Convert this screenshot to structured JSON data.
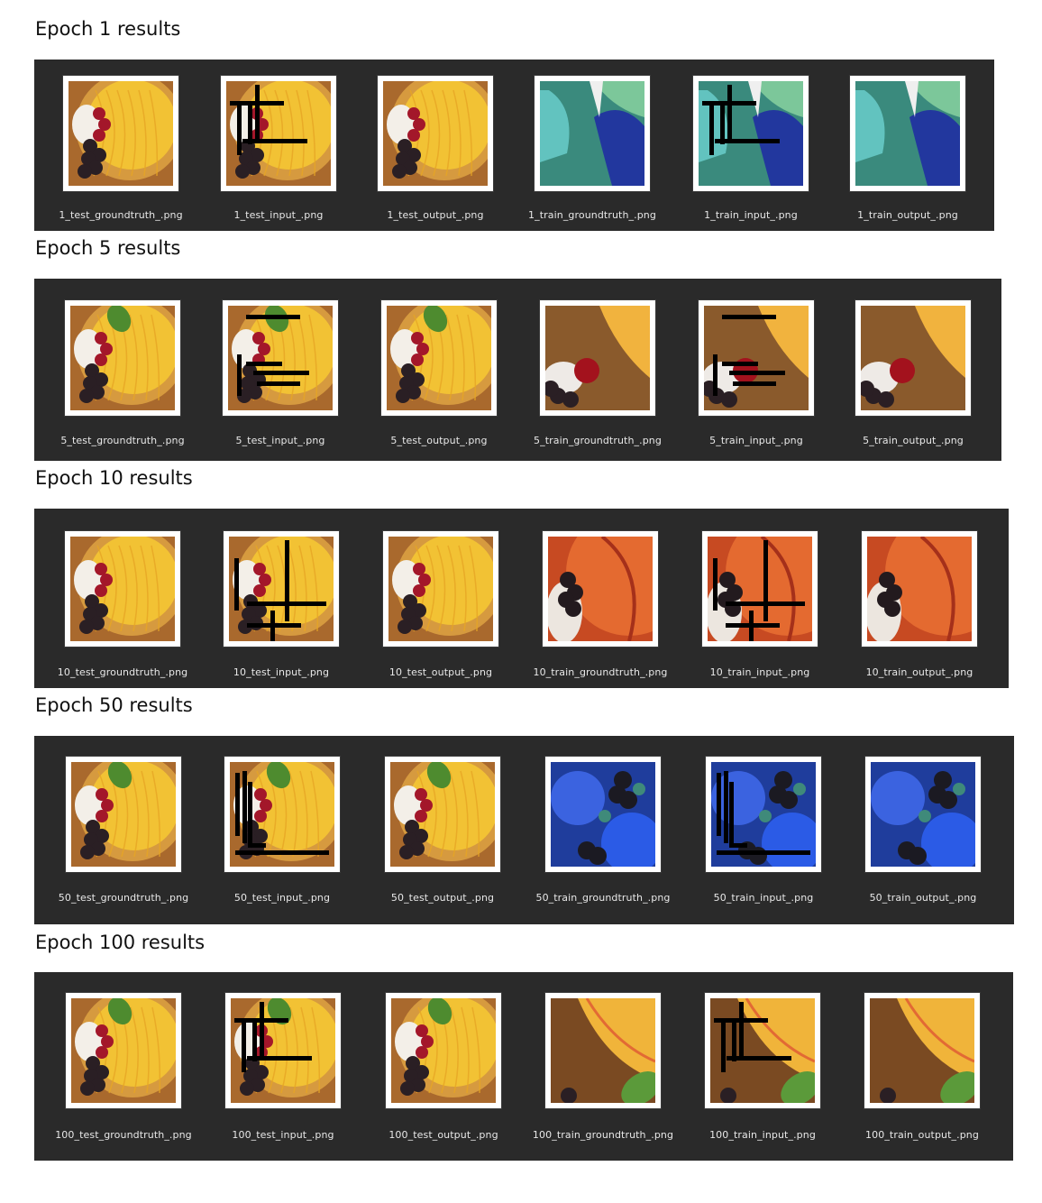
{
  "sections": [
    {
      "title": "Epoch 1 results",
      "files": [
        {
          "label": "1_test_groundtruth_.png",
          "scene": "tart",
          "mask": false,
          "accent": "#f2c234"
        },
        {
          "label": "1_test_input_.png",
          "scene": "tart",
          "mask": true,
          "accent": "#f2c234"
        },
        {
          "label": "1_test_output_.png",
          "scene": "tart",
          "mask": false,
          "accent": "#f2c234"
        },
        {
          "label": "1_train_groundtruth_.png",
          "scene": "teal",
          "mask": false,
          "accent": "#49b5a8"
        },
        {
          "label": "1_train_input_.png",
          "scene": "teal",
          "mask": true,
          "accent": "#49b5a8"
        },
        {
          "label": "1_train_output_.png",
          "scene": "teal",
          "mask": false,
          "accent": "#49b5a8"
        }
      ]
    },
    {
      "title": "Epoch 5 results",
      "files": [
        {
          "label": "5_test_groundtruth_.png",
          "scene": "tart-leaf",
          "mask": false,
          "accent": "#f2c234"
        },
        {
          "label": "5_test_input_.png",
          "scene": "tart-leaf",
          "mask": true,
          "accent": "#f2c234"
        },
        {
          "label": "5_test_output_.png",
          "scene": "tart-leaf",
          "mask": false,
          "accent": "#f2c234"
        },
        {
          "label": "5_train_groundtruth_.png",
          "scene": "cherry",
          "mask": false,
          "accent": "#e8a23c"
        },
        {
          "label": "5_train_input_.png",
          "scene": "cherry",
          "mask": true,
          "accent": "#e8a23c"
        },
        {
          "label": "5_train_output_.png",
          "scene": "cherry",
          "mask": false,
          "accent": "#e8a23c"
        }
      ]
    },
    {
      "title": "Epoch 10 results",
      "files": [
        {
          "label": "10_test_groundtruth_.png",
          "scene": "tart",
          "mask": false,
          "accent": "#f2c234"
        },
        {
          "label": "10_test_input_.png",
          "scene": "tart",
          "mask": true,
          "accent": "#f2c234"
        },
        {
          "label": "10_test_output_.png",
          "scene": "tart",
          "mask": false,
          "accent": "#f2c234"
        },
        {
          "label": "10_train_groundtruth_.png",
          "scene": "orange",
          "mask": false,
          "accent": "#e0602a"
        },
        {
          "label": "10_train_input_.png",
          "scene": "orange",
          "mask": true,
          "accent": "#e0602a"
        },
        {
          "label": "10_train_output_.png",
          "scene": "orange",
          "mask": false,
          "accent": "#e0602a"
        }
      ]
    },
    {
      "title": "Epoch 50 results",
      "files": [
        {
          "label": "50_test_groundtruth_.png",
          "scene": "tart-leaf",
          "mask": false,
          "accent": "#f2c234"
        },
        {
          "label": "50_test_input_.png",
          "scene": "tart-leaf",
          "mask": true,
          "accent": "#f2c234"
        },
        {
          "label": "50_test_output_.png",
          "scene": "tart-leaf",
          "mask": false,
          "accent": "#f2c234"
        },
        {
          "label": "50_train_groundtruth_.png",
          "scene": "blue",
          "mask": false,
          "accent": "#2f56d6"
        },
        {
          "label": "50_train_input_.png",
          "scene": "blue",
          "mask": true,
          "accent": "#2f56d6"
        },
        {
          "label": "50_train_output_.png",
          "scene": "blue",
          "mask": false,
          "accent": "#2f56d6"
        }
      ]
    },
    {
      "title": "Epoch 100 results",
      "files": [
        {
          "label": "100_test_groundtruth_.png",
          "scene": "tart-leaf",
          "mask": false,
          "accent": "#f2c234"
        },
        {
          "label": "100_test_input_.png",
          "scene": "tart-leaf",
          "mask": true,
          "accent": "#f2c234"
        },
        {
          "label": "100_test_output_.png",
          "scene": "tart-leaf",
          "mask": false,
          "accent": "#f2c234"
        },
        {
          "label": "100_train_groundtruth_.png",
          "scene": "peach",
          "mask": false,
          "accent": "#f0b43a"
        },
        {
          "label": "100_train_input_.png",
          "scene": "peach",
          "mask": true,
          "accent": "#f0b43a"
        },
        {
          "label": "100_train_output_.png",
          "scene": "peach",
          "mask": false,
          "accent": "#f0b43a"
        }
      ]
    }
  ]
}
